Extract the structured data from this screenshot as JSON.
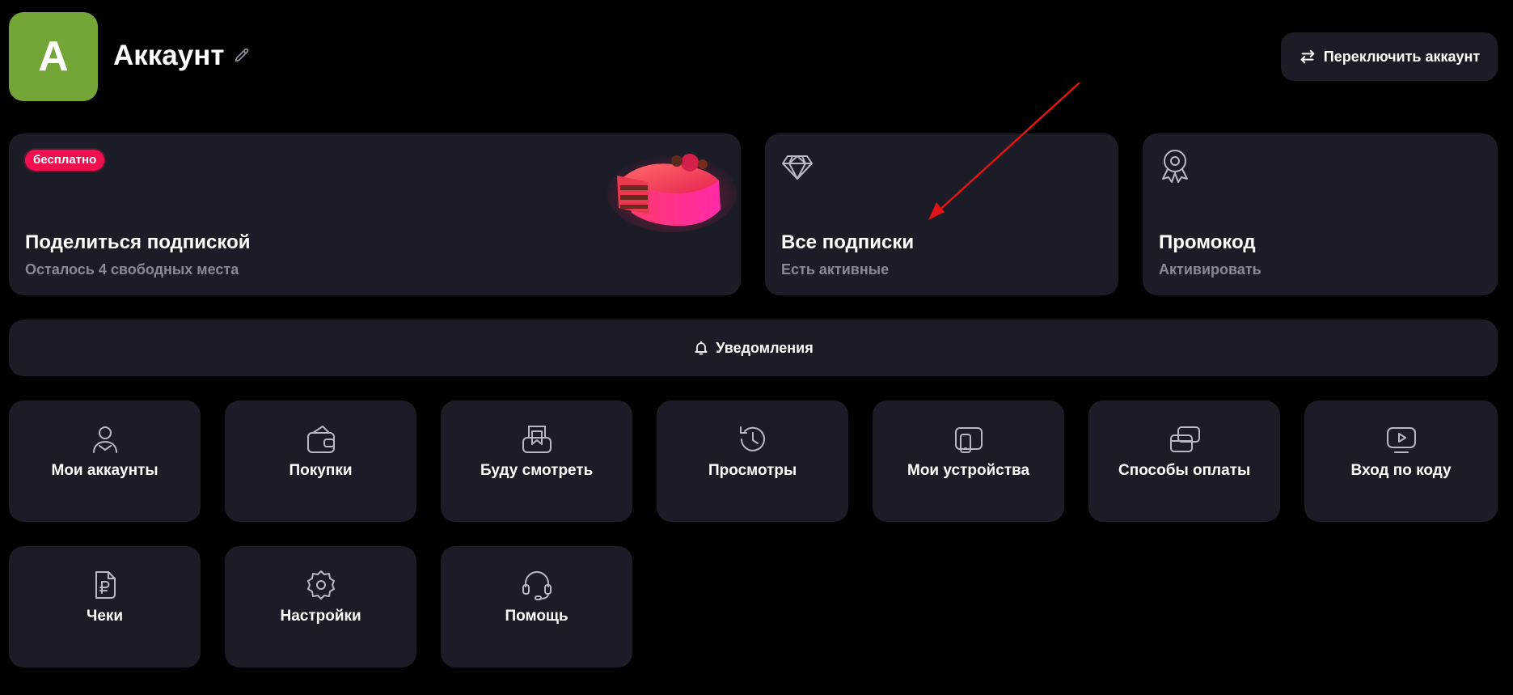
{
  "header": {
    "avatar_letter": "А",
    "title": "Аккаунт",
    "switch_account_label": "Переключить аккаунт"
  },
  "cards": {
    "share": {
      "badge": "бесплатно",
      "title": "Поделиться подпиской",
      "subtitle": "Осталось 4 свободных места"
    },
    "subscriptions": {
      "title": "Все подписки",
      "subtitle": "Есть активные"
    },
    "promo": {
      "title": "Промокод",
      "subtitle": "Активировать"
    }
  },
  "notifications_label": "Уведомления",
  "tiles_row1": [
    {
      "label": "Мои аккаунты",
      "icon": "user-icon"
    },
    {
      "label": "Покупки",
      "icon": "wallet-icon"
    },
    {
      "label": "Буду смотреть",
      "icon": "bookmark-icon"
    },
    {
      "label": "Просмотры",
      "icon": "history-icon"
    },
    {
      "label": "Мои устройства",
      "icon": "devices-icon"
    },
    {
      "label": "Способы оплаты",
      "icon": "cards-icon"
    },
    {
      "label": "Вход по коду",
      "icon": "play-screen-icon"
    }
  ],
  "tiles_row2": [
    {
      "label": "Чеки",
      "icon": "receipt-ruble-icon"
    },
    {
      "label": "Настройки",
      "icon": "gear-icon"
    },
    {
      "label": "Помощь",
      "icon": "headset-icon"
    }
  ],
  "colors": {
    "background": "#000000",
    "card": "#1c1c26",
    "avatar": "#73a537",
    "badge": "#f0104f",
    "muted_text": "#8a8a96",
    "annotation_arrow": "#e01414"
  }
}
